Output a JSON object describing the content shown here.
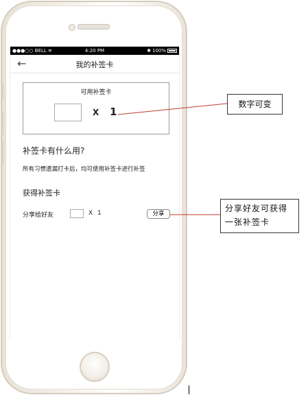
{
  "status_bar": {
    "carrier": "●●●○○ BELL",
    "wifi_icon": "wifi-icon",
    "time": "4:20 PM",
    "bluetooth_icon": "bluetooth-icon",
    "battery": "100%"
  },
  "nav": {
    "back_icon": "back-arrow-icon",
    "back_glyph": "←",
    "title": "我的补签卡"
  },
  "card": {
    "title": "可用补签卡",
    "multiplier": "X",
    "count": "1"
  },
  "info": {
    "question": "补签卡有什么用?",
    "description": "所有习惯遗漏打卡后，均可使用补签卡进行补签"
  },
  "obtain": {
    "title": "获得补签卡",
    "share_label": "分享给好友",
    "multiplier": "X",
    "count": "1",
    "share_button": "分享"
  },
  "annotations": {
    "note1": "数字可变",
    "note2": "分享好友可获得一张补签卡"
  },
  "colors": {
    "annotation_line": "#c0392b"
  }
}
